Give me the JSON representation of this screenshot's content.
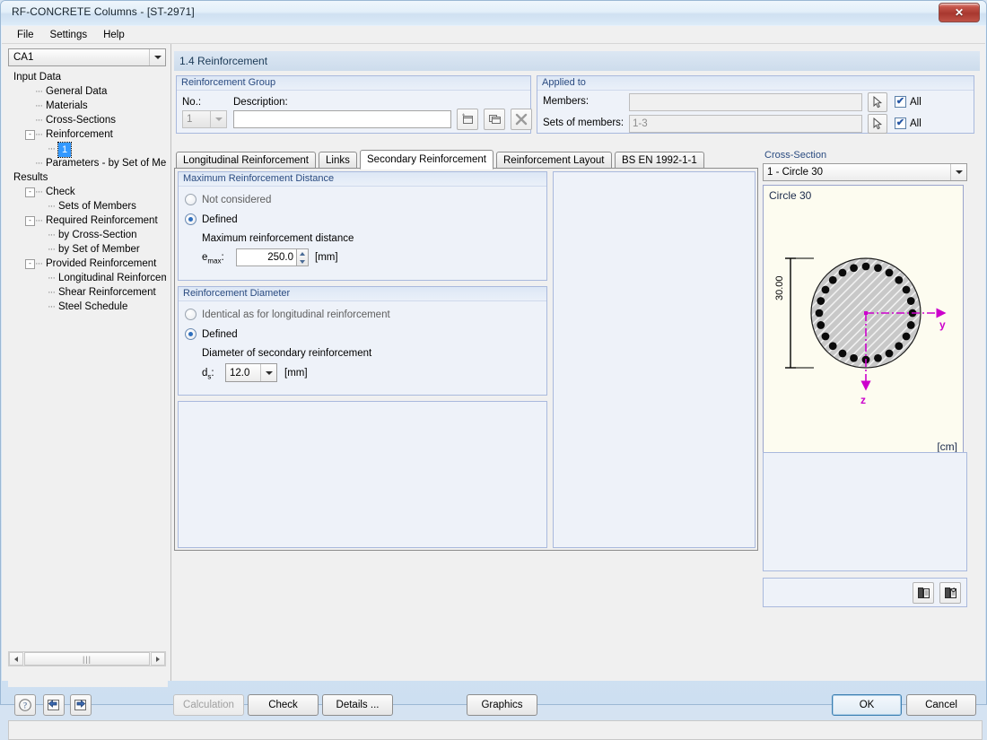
{
  "window": {
    "title": "RF-CONCRETE Columns - [ST-2971]",
    "close_label": "✕"
  },
  "menubar": {
    "items": [
      "File",
      "Settings",
      "Help"
    ]
  },
  "sidebar": {
    "combo_value": "CA1",
    "tree": [
      {
        "label": "Input Data",
        "depth": 0,
        "expander": "",
        "selected": false
      },
      {
        "label": "General Data",
        "depth": 1,
        "expander": "",
        "selected": false
      },
      {
        "label": "Materials",
        "depth": 1,
        "expander": "",
        "selected": false
      },
      {
        "label": "Cross-Sections",
        "depth": 1,
        "expander": "",
        "selected": false
      },
      {
        "label": "Reinforcement",
        "depth": 1,
        "expander": "-",
        "selected": false
      },
      {
        "label": "1",
        "depth": 2,
        "expander": "",
        "selected": true
      },
      {
        "label": "Parameters - by Set of Members",
        "depth": 1,
        "expander": "",
        "selected": false
      },
      {
        "label": "Results",
        "depth": 0,
        "expander": "",
        "selected": false
      },
      {
        "label": "Check",
        "depth": 1,
        "expander": "-",
        "selected": false
      },
      {
        "label": "Sets of Members",
        "depth": 2,
        "expander": "",
        "selected": false
      },
      {
        "label": "Required Reinforcement",
        "depth": 1,
        "expander": "-",
        "selected": false
      },
      {
        "label": "by Cross-Section",
        "depth": 2,
        "expander": "",
        "selected": false
      },
      {
        "label": "by Set of Member",
        "depth": 2,
        "expander": "",
        "selected": false
      },
      {
        "label": "Provided Reinforcement",
        "depth": 1,
        "expander": "-",
        "selected": false
      },
      {
        "label": "Longitudinal Reinforcement",
        "depth": 2,
        "expander": "",
        "selected": false
      },
      {
        "label": "Shear Reinforcement",
        "depth": 2,
        "expander": "",
        "selected": false
      },
      {
        "label": "Steel Schedule",
        "depth": 2,
        "expander": "",
        "selected": false
      }
    ]
  },
  "page": {
    "title": "1.4 Reinforcement"
  },
  "reinforcement_group": {
    "legend": "Reinforcement Group",
    "no_label": "No.:",
    "no_value": "1",
    "description_label": "Description:",
    "description_value": "",
    "description_placeholder": "",
    "new_icon": "new-window-icon",
    "copy_icon": "copy-window-icon",
    "delete_icon": "delete-x-icon"
  },
  "applied_to": {
    "legend": "Applied to",
    "members_label": "Members:",
    "members_value": "",
    "sets_label": "Sets of members:",
    "sets_value": "1-3",
    "pick_icon": "pick-cursor-icon",
    "all_label": "All",
    "members_all_checked": true,
    "sets_all_checked": true
  },
  "tabs": [
    {
      "label": "Longitudinal Reinforcement",
      "active": false
    },
    {
      "label": "Links",
      "active": false
    },
    {
      "label": "Secondary Reinforcement",
      "active": true
    },
    {
      "label": "Reinforcement Layout",
      "active": false
    },
    {
      "label": "BS EN 1992-1-1",
      "active": false
    }
  ],
  "max_distance": {
    "legend": "Maximum Reinforcement Distance",
    "opt_not_considered": "Not considered",
    "opt_defined": "Defined",
    "selected": "Defined",
    "field_caption": "Maximum reinforcement distance",
    "field_label": "e",
    "field_label_sub": "max",
    "field_colon": ":",
    "value": "250.0",
    "unit": "[mm]"
  },
  "diameter": {
    "legend": "Reinforcement Diameter",
    "opt_identical": "Identical as for longitudinal reinforcement",
    "opt_defined": "Defined",
    "selected": "Defined",
    "field_caption": "Diameter of secondary reinforcement",
    "field_label": "d",
    "field_label_sub": "s",
    "field_colon": ":",
    "value": "12.0",
    "unit": "[mm]"
  },
  "cross_section": {
    "legend": "Cross-Section",
    "combo_value": "1 - Circle 30",
    "drawing_title": "Circle 30",
    "dimension_label": "30.00",
    "axis_y": "y",
    "axis_z": "z",
    "units": "[cm]",
    "rebar_count": 24,
    "accent_color": "#cc00cc"
  },
  "panel_tools": {
    "tool1_icon": "view-detail-icon",
    "tool2_icon": "view-detail-refresh-icon"
  },
  "footer": {
    "help_icon": "help-question-icon",
    "prev_icon": "previous-arrow-icon",
    "next_icon": "next-arrow-icon",
    "calculation_label": "Calculation",
    "calculation_disabled": true,
    "check_label": "Check",
    "details_label": "Details ...",
    "graphics_label": "Graphics",
    "ok_label": "OK",
    "cancel_label": "Cancel"
  }
}
